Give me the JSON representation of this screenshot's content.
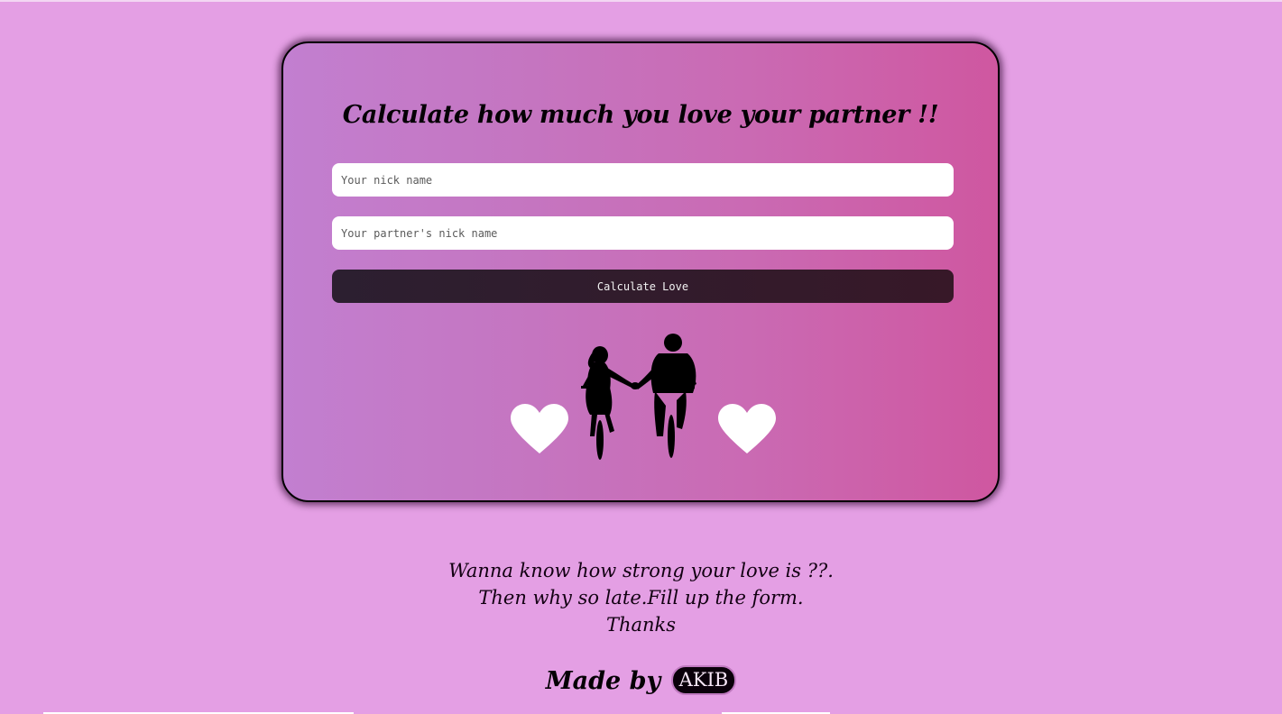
{
  "form": {
    "title": "Calculate how much you love your partner !!",
    "nick_name": {
      "placeholder": "Your nick name",
      "value": ""
    },
    "partner_nick_name": {
      "placeholder": "Your partner's nick name",
      "value": ""
    },
    "submit_label": "Calculate Love"
  },
  "illustration": {
    "left_icon": "heart-icon",
    "center_icon": "couple-on-bicycles-silhouette",
    "right_icon": "heart-icon"
  },
  "tagline": {
    "line1": "Wanna know how strong your love is ??.",
    "line2": "Then why so late.Fill up the form.",
    "line3": "Thanks"
  },
  "footer": {
    "made_by_label": "Made by",
    "author": "AKIB"
  },
  "colors": {
    "page_background": "#e49fe4",
    "card_gradient_start": "#c27fd0",
    "card_gradient_end": "#cf57a0",
    "button_background": "#2c1f30",
    "heart": "#ffffff"
  }
}
